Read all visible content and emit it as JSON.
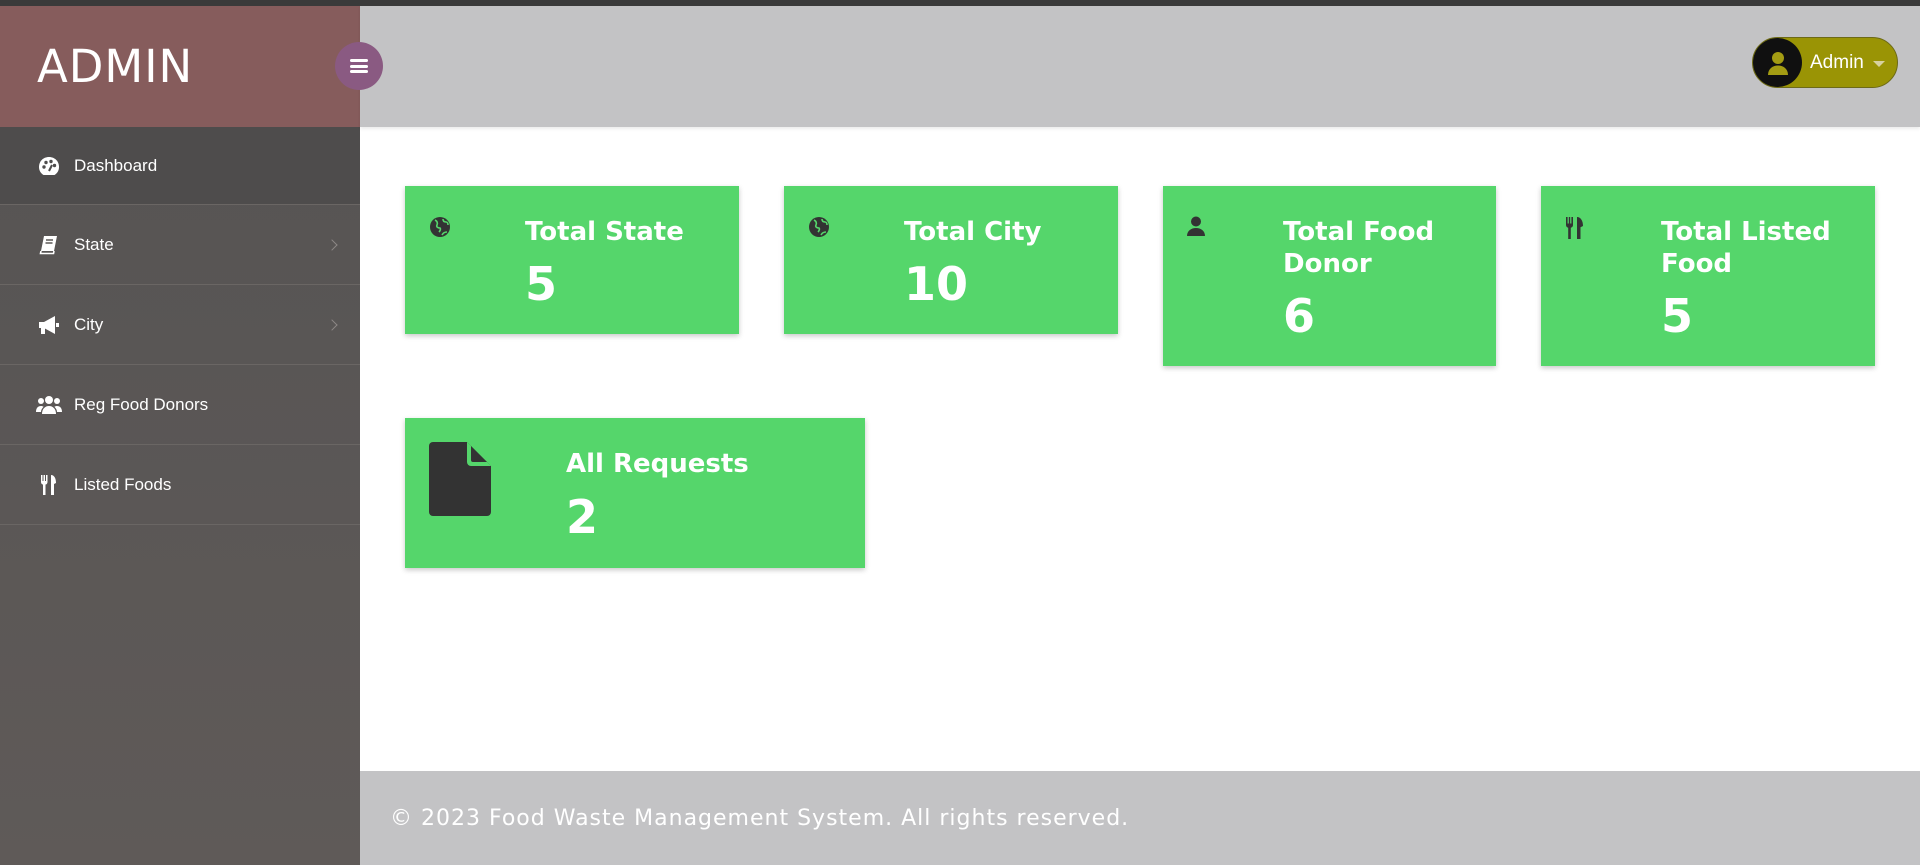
{
  "brand": {
    "title": "ADMIN"
  },
  "sidebar": {
    "items": [
      {
        "label": "Dashboard",
        "icon": "palette-icon",
        "active": true
      },
      {
        "label": "State",
        "icon": "book-icon",
        "has_submenu": true
      },
      {
        "label": "City",
        "icon": "bullhorn-icon",
        "has_submenu": true
      },
      {
        "label": "Reg Food Donors",
        "icon": "users-icon"
      },
      {
        "label": "Listed Foods",
        "icon": "utensils-icon"
      }
    ]
  },
  "header": {
    "user": {
      "name": "Admin",
      "icon": "user-icon"
    }
  },
  "cards": [
    {
      "title": "Total State",
      "value": "5",
      "icon": "globe-icon"
    },
    {
      "title": "Total City",
      "value": "10",
      "icon": "globe-icon"
    },
    {
      "title": "Total Food Donor",
      "value": "6",
      "icon": "user-icon"
    },
    {
      "title": "Total Listed Food",
      "value": "5",
      "icon": "utensils-icon"
    },
    {
      "title": "All Requests",
      "value": "2",
      "icon": "file-icon"
    }
  ],
  "footer": {
    "text": "© 2023 Food Waste Management System. All rights reserved."
  },
  "colors": {
    "brand_bg": "#865c5c",
    "sidebar_bg": "#5a5756",
    "header_bg": "#c3c3c5",
    "card_bg": "#55d66b",
    "toggle_bg": "#8a5a82",
    "user_pill_bg": "#9a9405"
  }
}
